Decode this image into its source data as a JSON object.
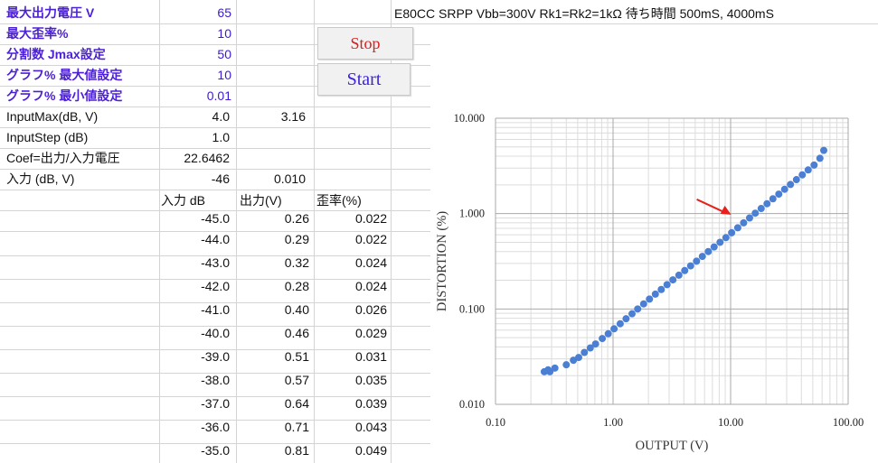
{
  "params": [
    {
      "label": "最大出力電圧 V",
      "value": "65"
    },
    {
      "label": "最大歪率%",
      "value": "10"
    },
    {
      "label": "分割数 Jmax設定",
      "value": "50"
    },
    {
      "label": "グラフ% 最大値設定",
      "value": "10"
    },
    {
      "label": "グラフ% 最小値設定",
      "value": "0.01"
    }
  ],
  "settings": [
    {
      "label": "InputMax(dB, V)",
      "value": "4.0",
      "extra": "3.16"
    },
    {
      "label": "InputStep (dB)",
      "value": "1.0",
      "extra": ""
    },
    {
      "label": "Coef=出力/入力電圧",
      "value": "22.6462",
      "extra": ""
    },
    {
      "label": "入力 (dB, V)",
      "value": "-46",
      "extra": "0.010"
    }
  ],
  "buttons": {
    "stop": "Stop",
    "start": "Start"
  },
  "title": "E80CC SRPP Vbb=300V Rk1=Rk2=1kΩ 待ち時間 500mS, 4000mS",
  "table": {
    "headers": [
      "入力 dB",
      "出力(V)",
      "歪率(%)"
    ],
    "rows": [
      [
        "-45.0",
        "0.26",
        "0.022"
      ],
      [
        "-44.0",
        "0.29",
        "0.022"
      ],
      [
        "-43.0",
        "0.32",
        "0.024"
      ],
      [
        "-42.0",
        "0.28",
        "0.024"
      ],
      [
        "-41.0",
        "0.40",
        "0.026"
      ],
      [
        "-40.0",
        "0.46",
        "0.029"
      ],
      [
        "-39.0",
        "0.51",
        "0.031"
      ],
      [
        "-38.0",
        "0.57",
        "0.035"
      ],
      [
        "-37.0",
        "0.64",
        "0.039"
      ],
      [
        "-36.0",
        "0.71",
        "0.043"
      ],
      [
        "-35.0",
        "0.81",
        "0.049"
      ]
    ]
  },
  "colors": {
    "accent_blue": "#4b1fd6",
    "stop_red": "#e01b1b",
    "marker": "#4a7fd4",
    "arrow": "#e8201c"
  },
  "chart_data": {
    "type": "scatter",
    "xscale": "log",
    "yscale": "log",
    "xlabel": "OUTPUT (V)",
    "ylabel": "DISTORTION (%)",
    "xlim": [
      0.1,
      100
    ],
    "ylim": [
      0.01,
      10
    ],
    "xticks": [
      "0.10",
      "1.00",
      "10.00",
      "100.00"
    ],
    "yticks": [
      "10.000",
      "1.000",
      "0.100",
      "0.010"
    ],
    "grid": true,
    "annotation": {
      "type": "arrow",
      "points_to": [
        12.5,
        0.8
      ]
    },
    "x": [
      0.26,
      0.28,
      0.29,
      0.32,
      0.4,
      0.46,
      0.51,
      0.57,
      0.64,
      0.71,
      0.81,
      0.91,
      1.02,
      1.15,
      1.29,
      1.45,
      1.62,
      1.82,
      2.04,
      2.29,
      2.57,
      2.88,
      3.23,
      3.63,
      4.07,
      4.57,
      5.13,
      5.75,
      6.46,
      7.24,
      8.13,
      9.12,
      10.2,
      11.5,
      12.9,
      14.5,
      16.2,
      18.2,
      20.4,
      22.9,
      25.7,
      28.8,
      32.3,
      36.3,
      40.7,
      45.7,
      51.3,
      57.5,
      62.0
    ],
    "y": [
      0.022,
      0.023,
      0.022,
      0.024,
      0.026,
      0.029,
      0.031,
      0.035,
      0.039,
      0.043,
      0.049,
      0.055,
      0.062,
      0.07,
      0.079,
      0.089,
      0.1,
      0.113,
      0.127,
      0.143,
      0.16,
      0.18,
      0.202,
      0.226,
      0.253,
      0.283,
      0.317,
      0.356,
      0.4,
      0.447,
      0.5,
      0.56,
      0.63,
      0.71,
      0.8,
      0.9,
      1.01,
      1.13,
      1.27,
      1.43,
      1.6,
      1.8,
      2.02,
      2.27,
      2.55,
      2.87,
      3.23,
      3.8,
      4.6
    ]
  }
}
